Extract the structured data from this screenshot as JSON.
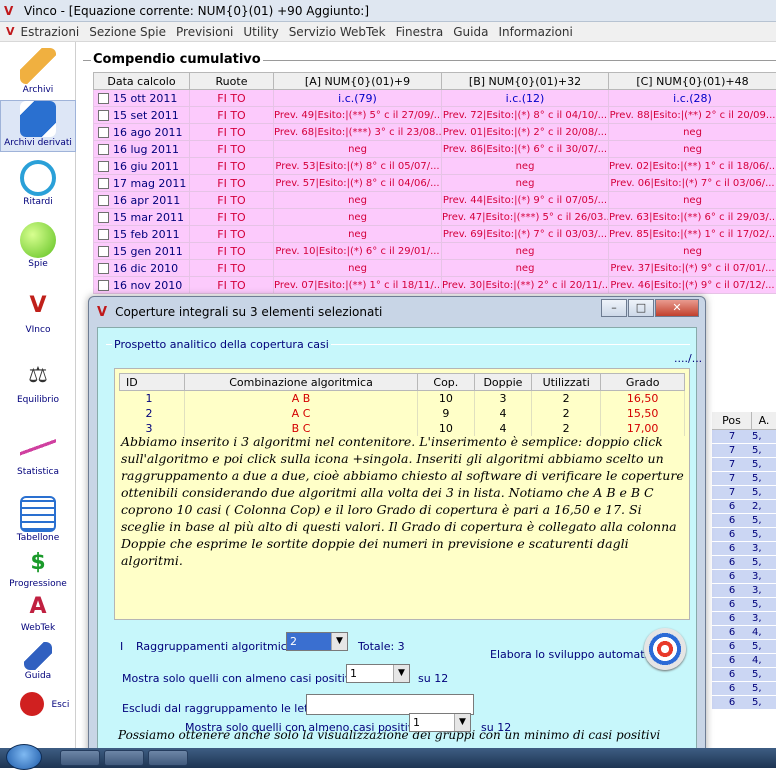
{
  "window": {
    "title": "Vinco - [Equazione corrente: NUM{0}(01) +90 Aggiunto:]"
  },
  "menu": [
    "Estrazioni",
    "Sezione Spie",
    "Previsioni",
    "Utility",
    "Servizio WebTek",
    "Finestra",
    "Guida",
    "Informazioni"
  ],
  "toolbar": [
    {
      "label": "Archivi",
      "icon": "pencil-icon",
      "color": "#e0a030"
    },
    {
      "label": "Archivi derivati",
      "icon": "pen-drive-icon",
      "color": "#2a70d0"
    },
    {
      "label": "Ritardi",
      "icon": "clock-icon",
      "color": "#2aa0d8"
    },
    {
      "label": "Spie",
      "icon": "flashlight-icon",
      "color": "#5ec020"
    },
    {
      "label": "VInco",
      "icon": "vinco-logo-icon",
      "color": "#c0201a"
    },
    {
      "label": "Equilibrio",
      "icon": "balance-scale-icon",
      "color": "#333333"
    },
    {
      "label": "Statistica",
      "icon": "chart-line-icon",
      "color": "#d040a0"
    },
    {
      "label": "Tabellone",
      "icon": "calendar-grid-icon",
      "color": "#2a70d0"
    },
    {
      "label": "Progressione",
      "icon": "dollar-icon",
      "color": "#1a9a2a"
    },
    {
      "label": "WebTek",
      "icon": "webtek-a-icon",
      "color": "#c02040"
    },
    {
      "label": "Guida",
      "icon": "guide-book-icon",
      "color": "#3060c0"
    },
    {
      "label": "Esci",
      "icon": "power-icon",
      "color": "#d02020"
    }
  ],
  "compendio": {
    "title": "Compendio cumulativo",
    "headers": [
      "Data calcolo",
      "Ruote",
      "[A] NUM{0}(01)+9",
      "[B] NUM{0}(01)+32",
      "[C] NUM{0}(01)+48"
    ],
    "rows": [
      {
        "date": "15 ott 2011",
        "ruote": "FI TO",
        "a": "i.c.(79)",
        "b": "i.c.(12)",
        "c": "i.c.(28)",
        "ic": true
      },
      {
        "date": "15 set 2011",
        "ruote": "FI TO",
        "a": "Prev. 49|Esito:|(**) 5° c il 27/09/...",
        "b": "Prev. 72|Esito:|(*) 8° c il 04/10/...",
        "c": "Prev. 88|Esito:|(**) 2° c il 20/09..."
      },
      {
        "date": "16 ago 2011",
        "ruote": "FI TO",
        "a": "Prev. 68|Esito:|(***) 3° c il 23/08...",
        "b": "Prev. 01|Esito:|(*) 2° c il 20/08/...",
        "c": "neg"
      },
      {
        "date": "16 lug 2011",
        "ruote": "FI TO",
        "a": "neg",
        "b": "Prev. 86|Esito:|(*) 6° c il 30/07/...",
        "c": "neg"
      },
      {
        "date": "16 giu 2011",
        "ruote": "FI TO",
        "a": "Prev. 53|Esito:|(*) 8° c il 05/07/...",
        "b": "neg",
        "c": "Prev. 02|Esito:|(**) 1° c il 18/06/..."
      },
      {
        "date": "17 mag 2011",
        "ruote": "FI TO",
        "a": "Prev. 57|Esito:|(*) 8° c il 04/06/...",
        "b": "neg",
        "c": "Prev. 06|Esito:|(*) 7° c il 03/06/..."
      },
      {
        "date": "16 apr 2011",
        "ruote": "FI TO",
        "a": "neg",
        "b": "Prev. 44|Esito:|(*) 9° c il 07/05/...",
        "c": "neg"
      },
      {
        "date": "15 mar 2011",
        "ruote": "FI TO",
        "a": "neg",
        "b": "Prev. 47|Esito:|(***) 5° c il 26/03...",
        "c": "Prev. 63|Esito:|(**) 6° c il 29/03/..."
      },
      {
        "date": "15 feb 2011",
        "ruote": "FI TO",
        "a": "neg",
        "b": "Prev. 69|Esito:|(*) 7° c il 03/03/...",
        "c": "Prev. 85|Esito:|(**) 1° c il 17/02/..."
      },
      {
        "date": "15 gen 2011",
        "ruote": "FI TO",
        "a": "Prev. 10|Esito:|(*) 6° c il 29/01/...",
        "b": "neg",
        "c": "neg"
      },
      {
        "date": "16 dic 2010",
        "ruote": "FI TO",
        "a": "neg",
        "b": "neg",
        "c": "Prev. 37|Esito:|(*) 9° c il 07/01/..."
      },
      {
        "date": "16 nov 2010",
        "ruote": "FI TO",
        "a": "Prev. 07|Esito:|(**) 1° c il 18/11/...",
        "b": "Prev. 30|Esito:|(**) 2° c il 20/11/...",
        "c": "Prev. 46|Esito:|(*) 9° c il 07/12/..."
      }
    ]
  },
  "side_grid": {
    "headers": [
      "Pos",
      "A."
    ],
    "rows": [
      [
        "7",
        "5,"
      ],
      [
        "7",
        "5,"
      ],
      [
        "7",
        "5,"
      ],
      [
        "7",
        "5,"
      ],
      [
        "7",
        "5,"
      ],
      [
        "6",
        "2,"
      ],
      [
        "6",
        "5,"
      ],
      [
        "6",
        "5,"
      ],
      [
        "6",
        "3,"
      ],
      [
        "6",
        "5,"
      ],
      [
        "6",
        "3,"
      ],
      [
        "6",
        "3,"
      ],
      [
        "6",
        "5,"
      ],
      [
        "6",
        "3,"
      ],
      [
        "6",
        "4,"
      ],
      [
        "6",
        "5,"
      ],
      [
        "6",
        "4,"
      ],
      [
        "6",
        "5,"
      ],
      [
        "6",
        "5,"
      ],
      [
        "6",
        "5,"
      ]
    ]
  },
  "dialog": {
    "title": "Coperture integrali su 3 elementi selezionati",
    "fieldset": "Prospetto analitico della copertura casi",
    "more": "..../...",
    "table": {
      "headers": [
        "ID",
        "Combinazione algoritmica",
        "Cop.",
        "Doppie",
        "Utilizzati",
        "Grado"
      ],
      "rows": [
        [
          "1",
          "A B",
          "10",
          "3",
          "2",
          "16,50"
        ],
        [
          "2",
          "A C",
          "9",
          "4",
          "2",
          "15,50"
        ],
        [
          "3",
          "B C",
          "10",
          "4",
          "2",
          "17,00"
        ]
      ]
    },
    "note": "Abbiamo inserito i 3 algoritmi nel contenitore. L'inserimento è semplice: doppio click sull'algoritmo e poi click sulla icona +singola. Inseriti gli algoritmi abbiamo scelto un raggruppamento a due a due, cioè abbiamo chiesto al software di verificare le coperture ottenibili considerando due algoritmi alla volta dei 3 in lista. Notiamo che A B e B C coprono 10 casi ( Colonna Cop) e il loro Grado di copertura è pari a 16,50 e 17. Si sceglie in base al più alto di questi valori. Il Grado di copertura è collegato alla colonna Doppie che esprime le sortite doppie dei numeri in previsione e scaturenti dagli algoritmi.",
    "raggruppamenti_label": "Raggruppamenti algoritmici da",
    "raggruppamenti_prefix": "I",
    "raggruppamenti_value": "2",
    "totale": "Totale: 3",
    "elabora_label": "Elabora lo sviluppo automatico",
    "mostra_label": "Mostra solo quelli con almeno casi positivi",
    "mostra_value": "1",
    "su": "su 12",
    "escludi_label": "Escludi dal raggruppamento le lettere:",
    "escludi_value": "",
    "note2": "Possiamo ottenere anche solo la visualizzazione dei gruppi con un minimo di casi positivi",
    "mostra2_label": "Mostra solo quelli con almeno casi positivi",
    "mostra2_value": "1",
    "su2": "su 12"
  }
}
